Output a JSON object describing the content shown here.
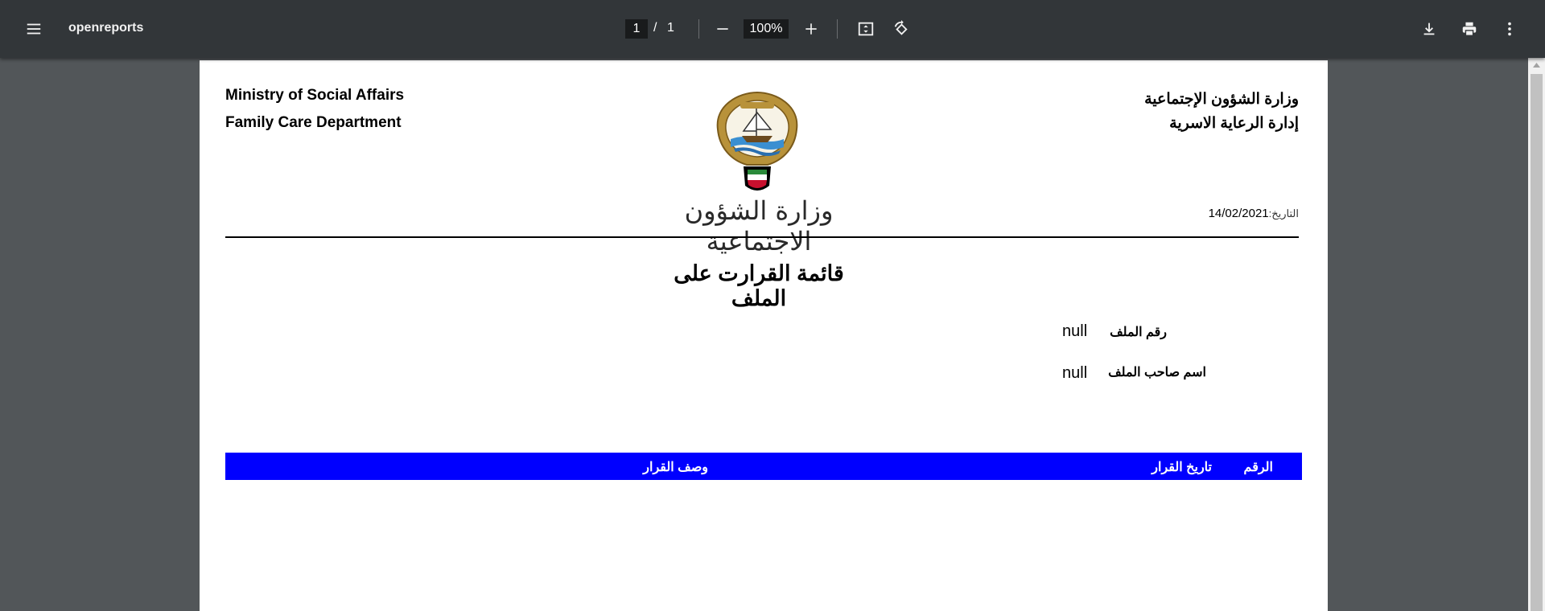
{
  "viewer": {
    "title": "openreports",
    "page_current": "1",
    "page_separator": "/",
    "page_total": "1",
    "zoom": "100%"
  },
  "icons": {
    "menu": "menu-icon",
    "zoom_out": "minus-icon",
    "zoom_in": "plus-icon",
    "fit": "fit-page-icon",
    "rotate": "rotate-icon",
    "download": "download-icon",
    "print": "print-icon",
    "more": "more-vert-icon"
  },
  "document": {
    "header_en": {
      "line1": "Ministry of Social Affairs",
      "line2": "Family Care Department"
    },
    "header_ar": {
      "line1": "وزارة الشؤون الإجتماعية",
      "line2": "إدارة الرعاية الاسرية"
    },
    "ministry_script": "وزارة الشؤون الاجتماعية",
    "date_label": "التاريخ:",
    "date_value": "14/02/2021",
    "report_title": "قائمة القرارت على الملف",
    "fields": [
      {
        "label": "رقم الملف",
        "value": "null"
      },
      {
        "label": "اسم صاحب الملف",
        "value": "null"
      }
    ],
    "table": {
      "columns": [
        "الرقم",
        "تاريخ القرار",
        "وصف القرار"
      ],
      "header_color": "#0000ff",
      "rows": []
    }
  },
  "colors": {
    "toolbar": "#323639",
    "background": "#525659",
    "page": "#ffffff"
  }
}
